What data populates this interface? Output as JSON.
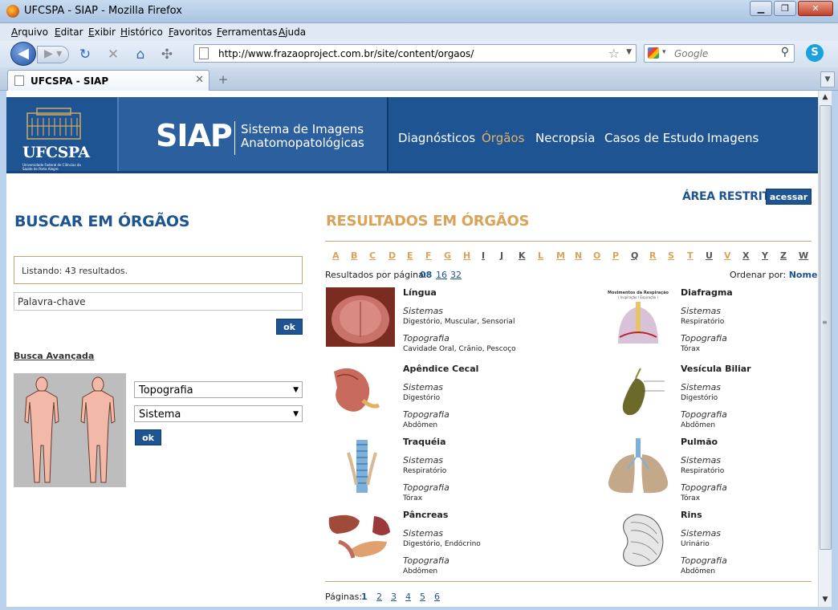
{
  "window": {
    "title": "UFCSPA - SIAP - Mozilla Firefox"
  },
  "menu": [
    "Arquivo",
    "Editar",
    "Exibir",
    "Histórico",
    "Favoritos",
    "Ferramentas",
    "Ajuda"
  ],
  "nav": {
    "url": "http://www.frazaoproject.com.br/site/content/orgaos/",
    "search_placeholder": "Google"
  },
  "tab": {
    "label": "UFCSPA - SIAP"
  },
  "site": {
    "logo_name": "UFCSPA",
    "logo_sub": "Universidade Federal de Ciências da Saúde de Porto Alegre",
    "brand": "SIAP",
    "tagline_1": "Sistema de Imagens",
    "tagline_2": "Anatomopatológicas",
    "menu": [
      "Diagnósticos",
      "Órgãos",
      "Necropsia",
      "Casos de Estudo",
      "Imagens"
    ],
    "active_menu": "Órgãos",
    "restricted_label": "ÁREA RESTRITA",
    "restricted_button": "acessar"
  },
  "search": {
    "title": "BUSCAR EM ÓRGÃOS",
    "listing": "Listando: 43 resultados.",
    "keyword_value": "Palavra-chave",
    "ok_label": "ok",
    "advanced_label": "Busca Avançada",
    "topografia_value": "Topografia",
    "sistema_value": "Sistema"
  },
  "results": {
    "title": "RESULTADOS EM ÓRGÃOS",
    "alphabet": [
      "A",
      "B",
      "C",
      "D",
      "E",
      "F",
      "G",
      "H",
      "I",
      "J",
      "K",
      "L",
      "M",
      "N",
      "O",
      "P",
      "Q",
      "R",
      "S",
      "T",
      "U",
      "V",
      "X",
      "Y",
      "Z",
      "W"
    ],
    "alphabet_active": [
      "A",
      "B",
      "C",
      "D",
      "E",
      "F",
      "G",
      "H",
      "L",
      "M",
      "N",
      "O",
      "P",
      "R",
      "S",
      "T",
      "V"
    ],
    "per_page_label": "Resultados por página:",
    "per_page_options": [
      "08",
      "16",
      "32"
    ],
    "per_page_current": "08",
    "order_label": "Ordenar por:",
    "order_value": "Nome",
    "sistemas_label": "Sistemas",
    "topografia_label": "Topografia",
    "items": [
      {
        "name": "Língua",
        "sistemas": "Digestório, Muscular, Sensorial",
        "topografia": "Cavidade Oral, Crânio, Pescoço"
      },
      {
        "name": "Diafragma",
        "sistemas": "Respiratório",
        "topografia": "Tórax"
      },
      {
        "name": "Apêndice Cecal",
        "sistemas": "Digestório",
        "topografia": "Abdômen"
      },
      {
        "name": "Vesícula Biliar",
        "sistemas": "Digestório",
        "topografia": "Abdômen"
      },
      {
        "name": "Traquéia",
        "sistemas": "Respiratório",
        "topografia": "Tórax"
      },
      {
        "name": "Pulmão",
        "sistemas": "Respiratório",
        "topografia": "Tórax"
      },
      {
        "name": "Pâncreas",
        "sistemas": "Digestório, Endócrino",
        "topografia": "Abdômen"
      },
      {
        "name": "Rins",
        "sistemas": "Urinário",
        "topografia": "Abdômen"
      }
    ],
    "pages_label": "Páginas:",
    "pages": [
      "1",
      "2",
      "3",
      "4",
      "5",
      "6"
    ],
    "page_current": "1"
  },
  "thumb_texts": {
    "diafragma": "Movimentos da Respiração",
    "diafragma_sub": "( Inspiração / Expiração )"
  }
}
